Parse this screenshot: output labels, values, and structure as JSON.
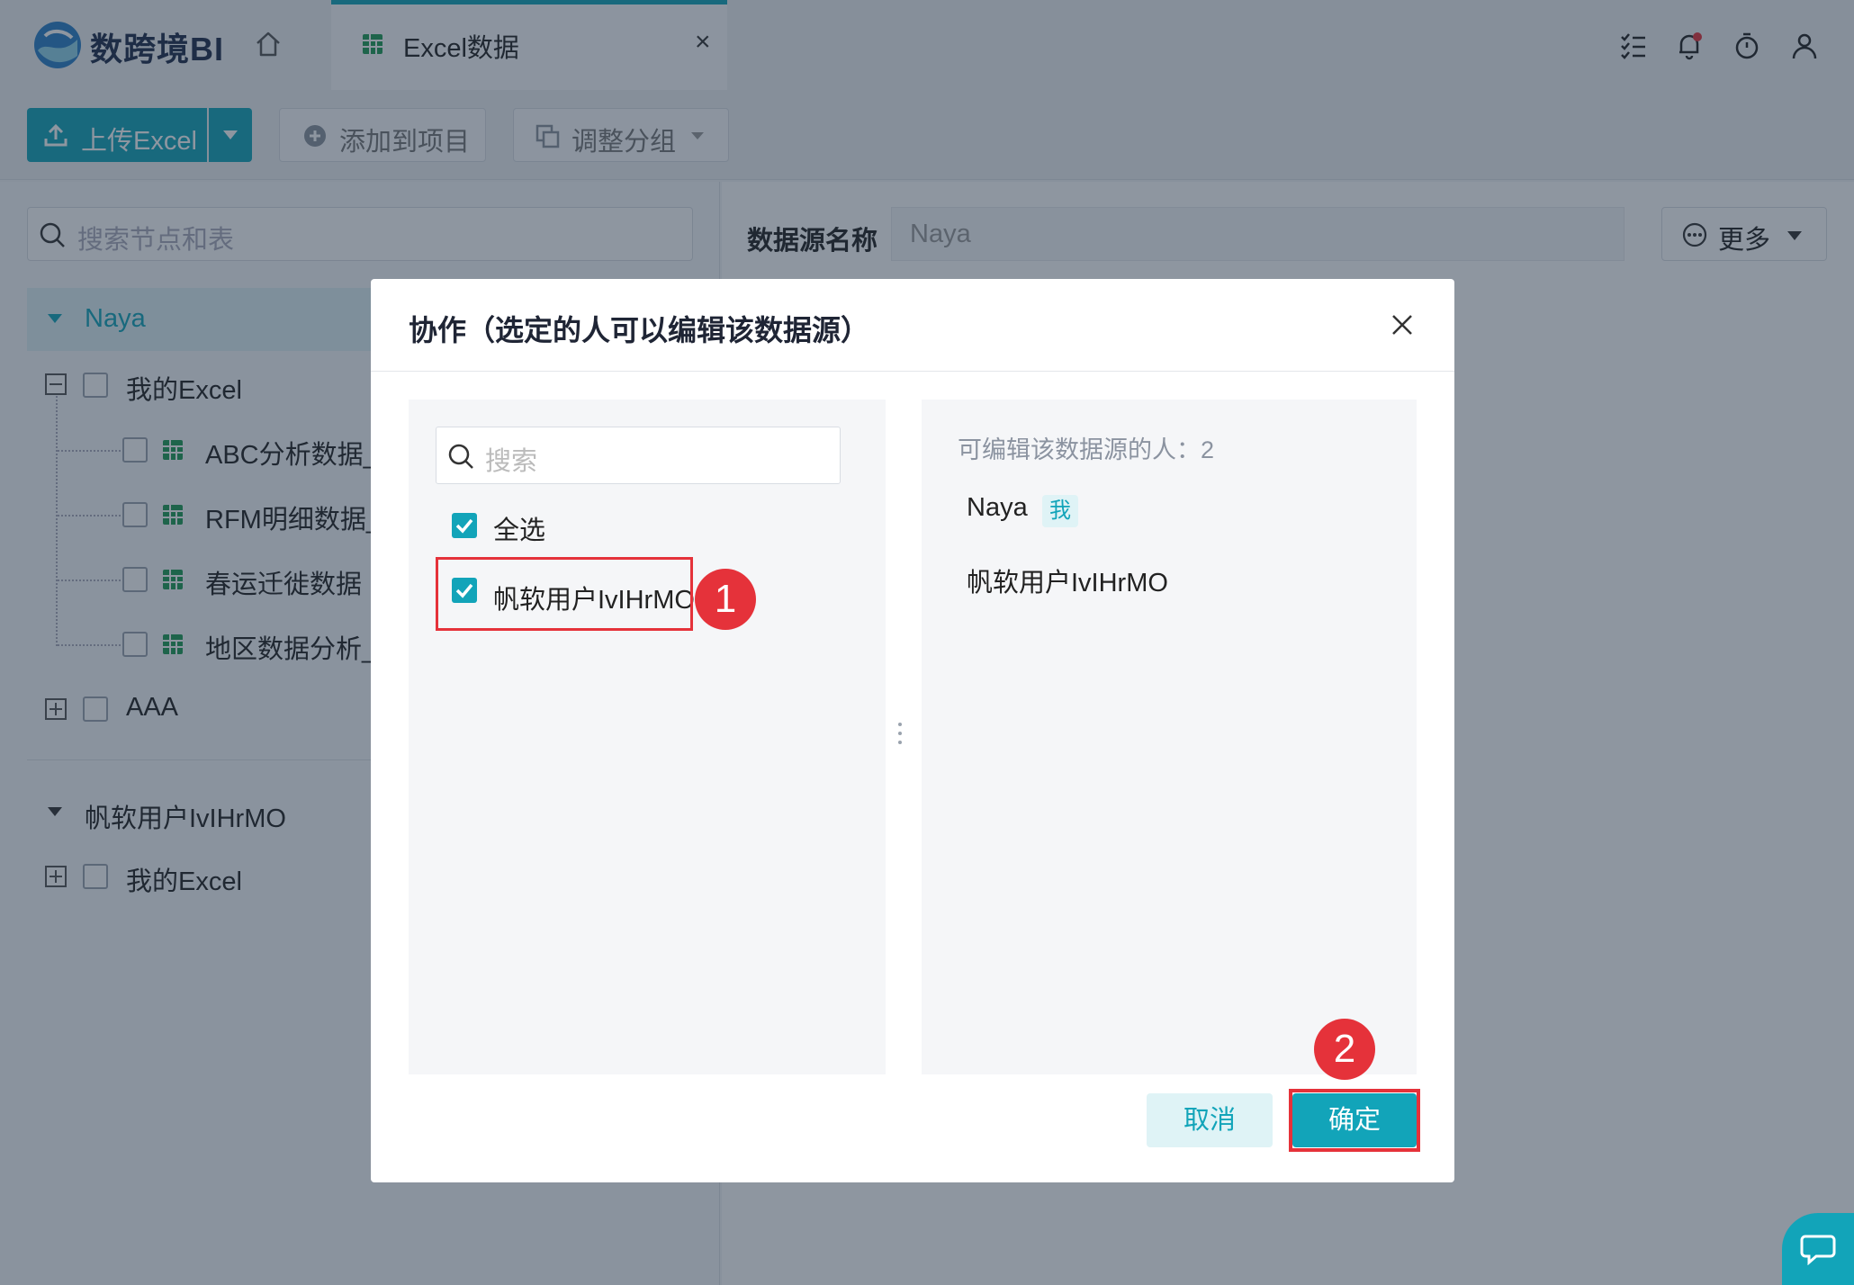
{
  "header": {
    "brand": "数跨境BI",
    "tab_label": "Excel数据",
    "tab_close": "×"
  },
  "toolbar": {
    "upload_label": "上传Excel",
    "add_to_project_label": "添加到项目",
    "adjust_group_label": "调整分组"
  },
  "left_panel": {
    "search_placeholder": "搜索节点和表",
    "tree": {
      "group_1": "Naya",
      "folder_1": "我的Excel",
      "files": [
        "ABC分析数据_",
        "RFM明细数据_",
        "春运迁徙数据",
        "地区数据分析_"
      ],
      "folder_2": "AAA",
      "group_2": "帆软用户IvIHrMO",
      "folder_3": "我的Excel"
    }
  },
  "main": {
    "datasource_label": "数据源名称",
    "datasource_value": "Naya",
    "more_label": "更多"
  },
  "modal": {
    "title": "协作（选定的人可以编辑该数据源）",
    "search_placeholder": "搜索",
    "select_all_label": "全选",
    "user_option_label": "帆软用户IvIHrMO",
    "editors_heading": "可编辑该数据源的人：2",
    "editors": [
      "Naya",
      "帆软用户IvIHrMO"
    ],
    "me_badge": "我",
    "cancel_label": "取消",
    "ok_label": "确定"
  },
  "annotations": {
    "marker_1": "1",
    "marker_2": "2"
  },
  "colors": {
    "accent": "#12a4b9",
    "highlight": "#e5323a"
  }
}
